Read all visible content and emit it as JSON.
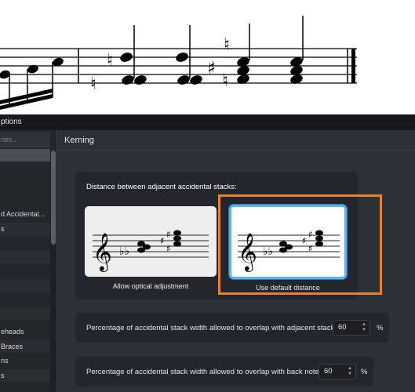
{
  "dialog": {
    "title": "ptions",
    "search_placeholder": "ries...",
    "section_title": "Kerning"
  },
  "sidebar": {
    "items": [
      {
        "label": ""
      },
      {
        "label": ""
      },
      {
        "label": ""
      },
      {
        "label": ""
      },
      {
        "label": "d Accidental..."
      },
      {
        "label": "s"
      },
      {
        "label": ""
      },
      {
        "label": ""
      },
      {
        "label": ""
      },
      {
        "label": ""
      },
      {
        "label": ""
      },
      {
        "label": ""
      },
      {
        "label": "eheads"
      },
      {
        "label": "Braces"
      },
      {
        "label": "ns"
      },
      {
        "label": "s"
      },
      {
        "label": ""
      },
      {
        "label": ""
      }
    ]
  },
  "kerning": {
    "group_label": "Distance between adjacent accidental stacks:",
    "options": [
      {
        "caption": "Allow optical adjustment",
        "selected": false
      },
      {
        "caption": "Use default distance",
        "selected": true
      }
    ]
  },
  "settings": [
    {
      "label": "Percentage of accidental stack width allowed to overlap with adjacent stack:",
      "value": "60",
      "unit": "%"
    },
    {
      "label": "Percentage of accidental stack width allowed to overlap with back note:",
      "value": "60",
      "unit": "%"
    }
  ],
  "colors": {
    "highlight": "#e9822c",
    "selection": "#5ab4f0",
    "dialog_bg": "#2c3037"
  }
}
